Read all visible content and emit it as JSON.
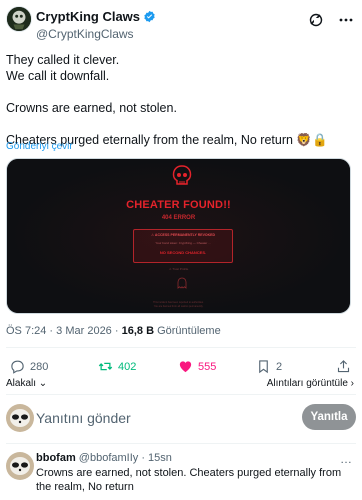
{
  "tweet": {
    "display_name": "CryptKing Claws",
    "handle": "@CryptKingClaws",
    "lines": [
      "They called it clever.",
      "We call it downfall.",
      "Crowns are earned, not stolen.",
      "Cheaters purged eternally from the realm, No return 🦁🔒"
    ],
    "translate_label": "Gönderiyi çevir"
  },
  "media": {
    "title": "CHEATER FOUND!!",
    "code": "404 ERROR",
    "box_line1": "⚠ ACCESS PERMANENTLY REVOKED",
    "box_line2": "Your bond token: CryptKing — Cheater ...",
    "box_line3": "NO SECOND CHANCES.",
    "trust_note": "⚠ Trust Profile",
    "footer_note": "This incident has been reported to authorities.\nYou are banned from all realms permanently."
  },
  "meta": {
    "time": "ÖS 7:24",
    "dot": "·",
    "date": "3 Mar 2026",
    "views_count": "16,8 B",
    "views_label": "Görüntüleme"
  },
  "actions": {
    "reply_count": "280",
    "retweet_count": "402",
    "like_count": "555",
    "bookmark_count": "2"
  },
  "quotes_label": "Alakalı",
  "view_quotes_label": "Alıntıları görüntüle ›",
  "alakali_arrow": "⌄",
  "reply_box": {
    "placeholder": "Yanıtını gönder",
    "button": "Yanıtla"
  },
  "reply": {
    "name": "bbofam",
    "handle": "@bbofamIIy",
    "time": "· 15sn",
    "more": "…",
    "text": "Crowns are earned, not stolen.  Cheaters purged eternally from the realm, No return"
  },
  "colors": {
    "accent": "#1d9bf0",
    "retweet": "#00ba7c",
    "like": "#f91880",
    "alert_red": "#e4232b"
  }
}
